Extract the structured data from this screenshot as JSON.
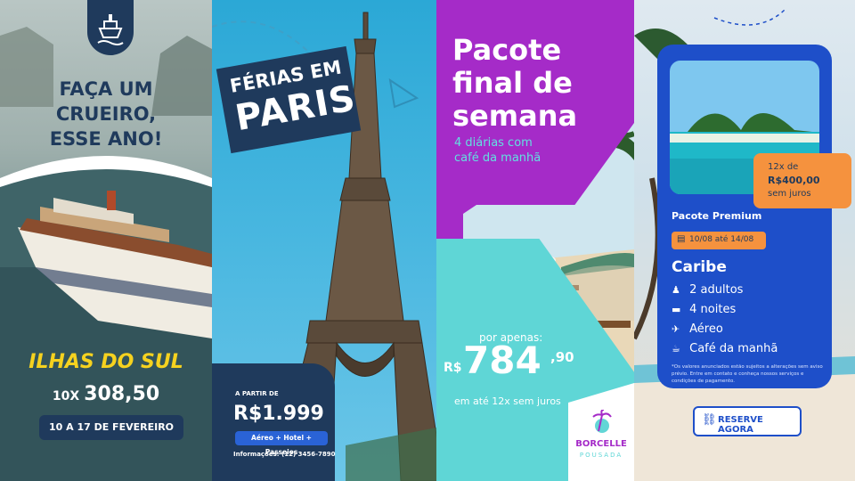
{
  "cruise": {
    "headline": [
      "FAÇA UM",
      "CRUEIRO,",
      "ESSE ANO!"
    ],
    "destination": "ILHAS DO SUL",
    "installments": "10X",
    "price": "308,50",
    "dates": "10 A 17 DE FEVEREIRO",
    "icon": "ship-icon"
  },
  "paris": {
    "title_line1": "FÉRIAS EM",
    "title_line2": "PARIS",
    "from_label": "A PARTIR DE",
    "price": "R$1.999",
    "includes": "Aéreo + Hotel + Passeios",
    "info": "Informações: (12) 3456-7890"
  },
  "weekend": {
    "title": [
      "Pacote",
      "final de",
      "semana"
    ],
    "subtitle": [
      "4 diárias com",
      "café da manhã"
    ],
    "for_only": "por apenas:",
    "currency": "R$",
    "price_int": "784",
    "price_cents": ",90",
    "installments": "em até 12x sem juros",
    "brand": "BORCELLE",
    "brand_sub": "POUSADA"
  },
  "caribe": {
    "installments_label": "12x de",
    "installment_value": "R$400,00",
    "no_interest": "sem juros",
    "package": "Pacote Premium",
    "dates": "10/08 até 14/08",
    "destination": "Caribe",
    "features": [
      {
        "icon": "people-icon",
        "label": "2 adultos"
      },
      {
        "icon": "bed-icon",
        "label": "4 noites"
      },
      {
        "icon": "plane-icon",
        "label": "Aéreo"
      },
      {
        "icon": "coffee-icon",
        "label": "Café da manhã"
      }
    ],
    "disclaimer": "*Os valores anunciados estão sujeitos a alterações sem aviso prévio. Entre em contato e conheça nossos serviços e condições de pagamento.",
    "cta": "RESERVE AGORA"
  },
  "colors": {
    "navy": "#1f3a5c",
    "yellow": "#f6d21f",
    "purple": "#a52bc8",
    "teal": "#5fd6d6",
    "orange": "#f5923e",
    "blue": "#1e4fc9"
  }
}
